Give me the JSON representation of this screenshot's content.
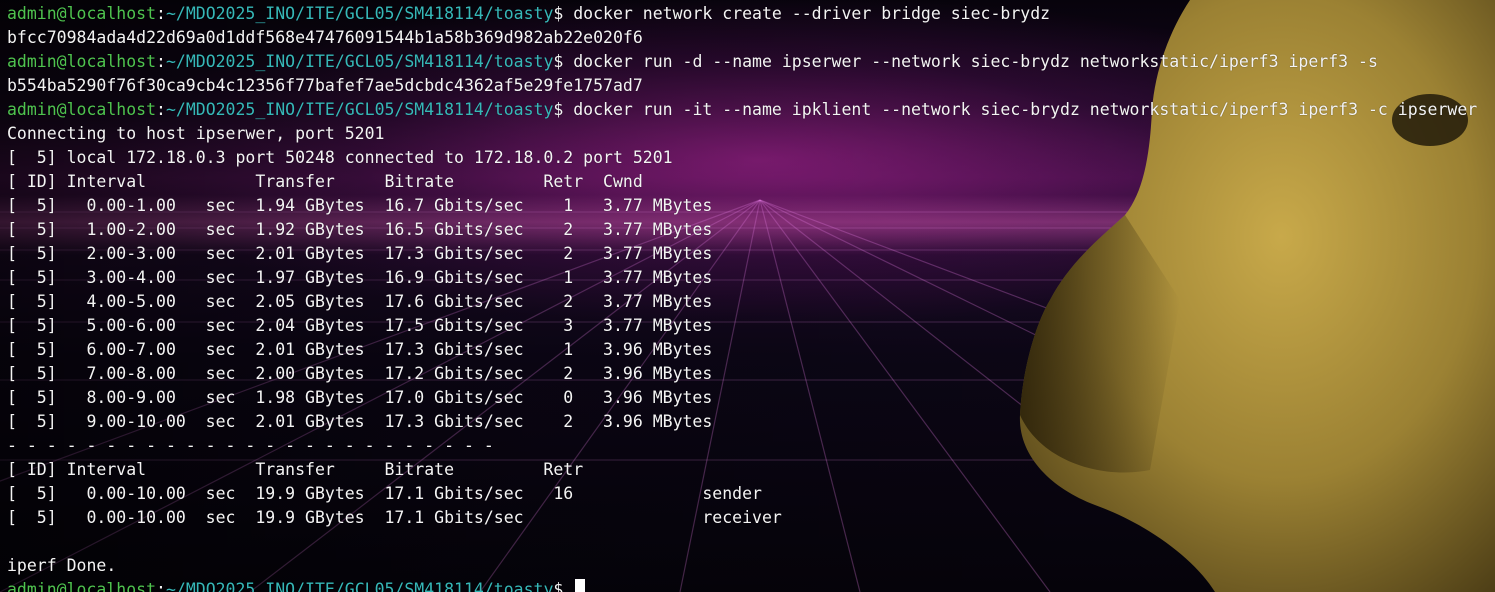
{
  "colors": {
    "prompt_user": "#4fc34f",
    "prompt_path": "#36b8b8",
    "text": "#f4f4f4",
    "background_glow": "#c428aa"
  },
  "prompt": {
    "user_host": "admin@localhost",
    "colon": ":",
    "path": "~/MDO2025_INO/ITE/GCL05/SM418114/toasty",
    "dollar": "$ "
  },
  "commands": [
    "docker network create --driver bridge siec-brydz",
    "docker run -d --name ipserwer --network siec-brydz networkstatic/iperf3 iperf3 -s",
    "docker run -it --name ipklient --network siec-brydz networkstatic/iperf3 iperf3 -c ipserwer"
  ],
  "outputs": {
    "network_id": "bfcc70984ada4d22d69a0d1ddf568e47476091544b1a58b369d982ab22e020f6",
    "container_id": "b554ba5290f76f30ca9cb4c12356f77bafef7ae5dcbdc4362af5e29fe1757ad7",
    "connecting": "Connecting to host ipserwer, port 5201",
    "local_connected": "[  5] local 172.18.0.3 port 50248 connected to 172.18.0.2 port 5201",
    "interval_header": "[ ID] Interval           Transfer     Bitrate         Retr  Cwnd",
    "intervals": [
      "[  5]   0.00-1.00   sec  1.94 GBytes  16.7 Gbits/sec    1   3.77 MBytes",
      "[  5]   1.00-2.00   sec  1.92 GBytes  16.5 Gbits/sec    2   3.77 MBytes",
      "[  5]   2.00-3.00   sec  2.01 GBytes  17.3 Gbits/sec    2   3.77 MBytes",
      "[  5]   3.00-4.00   sec  1.97 GBytes  16.9 Gbits/sec    1   3.77 MBytes",
      "[  5]   4.00-5.00   sec  2.05 GBytes  17.6 Gbits/sec    2   3.77 MBytes",
      "[  5]   5.00-6.00   sec  2.04 GBytes  17.5 Gbits/sec    3   3.77 MBytes",
      "[  5]   6.00-7.00   sec  2.01 GBytes  17.3 Gbits/sec    1   3.96 MBytes",
      "[  5]   7.00-8.00   sec  2.00 GBytes  17.2 Gbits/sec    2   3.96 MBytes",
      "[  5]   8.00-9.00   sec  1.98 GBytes  17.0 Gbits/sec    0   3.96 MBytes",
      "[  5]   9.00-10.00  sec  2.01 GBytes  17.3 Gbits/sec    2   3.96 MBytes"
    ],
    "separator": "- - - - - - - - - - - - - - - - - - - - - - - - -",
    "summary_header": "[ ID] Interval           Transfer     Bitrate         Retr",
    "summary_sender": "[  5]   0.00-10.00  sec  19.9 GBytes  17.1 Gbits/sec   16             sender",
    "summary_receiver": "[  5]   0.00-10.00  sec  19.9 GBytes  17.1 Gbits/sec                  receiver",
    "blank": "",
    "done": "iperf Done."
  },
  "background": {
    "icons": [
      "synthwave-grid-icon",
      "dog-silhouette-icon"
    ]
  }
}
